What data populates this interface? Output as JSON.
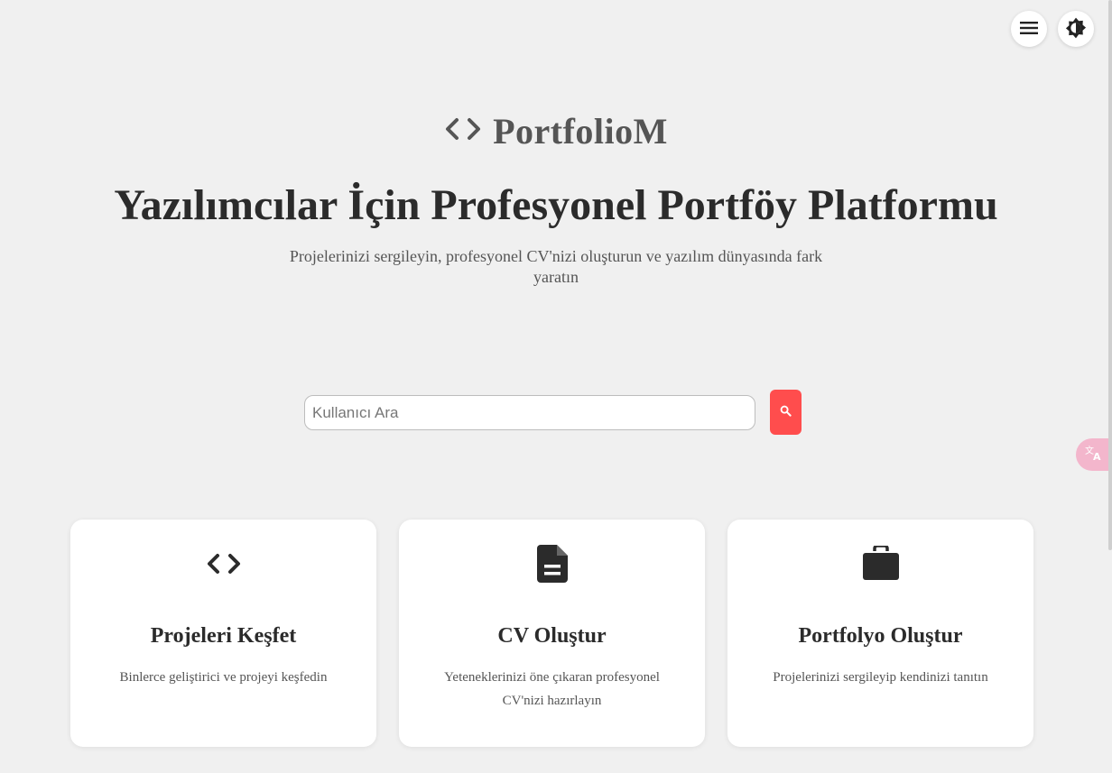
{
  "colors": {
    "background": "#f0f0f0",
    "accent": "#ff4d4d",
    "text": "#2b2b2b",
    "muted": "#555555",
    "translate": "#f3b6cc"
  },
  "top_controls": {
    "menu_icon": "menu-icon",
    "theme_icon": "brightness-icon"
  },
  "logo": {
    "icon": "code-icon",
    "text": "PortfolioM"
  },
  "hero": {
    "title": "Yazılımcılar İçin Profesyonel Portföy Platformu",
    "subtitle": "Projelerinizi sergileyin, profesyonel CV'nizi oluşturun ve yazılım dünyasında fark yaratın"
  },
  "search": {
    "placeholder": "Kullanıcı Ara",
    "value": "",
    "button_icon": "search-icon"
  },
  "translate": {
    "icon": "translate-icon"
  },
  "cards": [
    {
      "icon": "code-icon",
      "title": "Projeleri Keşfet",
      "description": "Binlerce geliştirici ve projeyi keşfedin"
    },
    {
      "icon": "document-icon",
      "title": "CV Oluştur",
      "description": "Yeteneklerinizi öne çıkaran profesyonel CV'nizi hazırlayın"
    },
    {
      "icon": "briefcase-icon",
      "title": "Portfolyo Oluştur",
      "description": "Projelerinizi sergileyip kendinizi tanıtın"
    }
  ]
}
